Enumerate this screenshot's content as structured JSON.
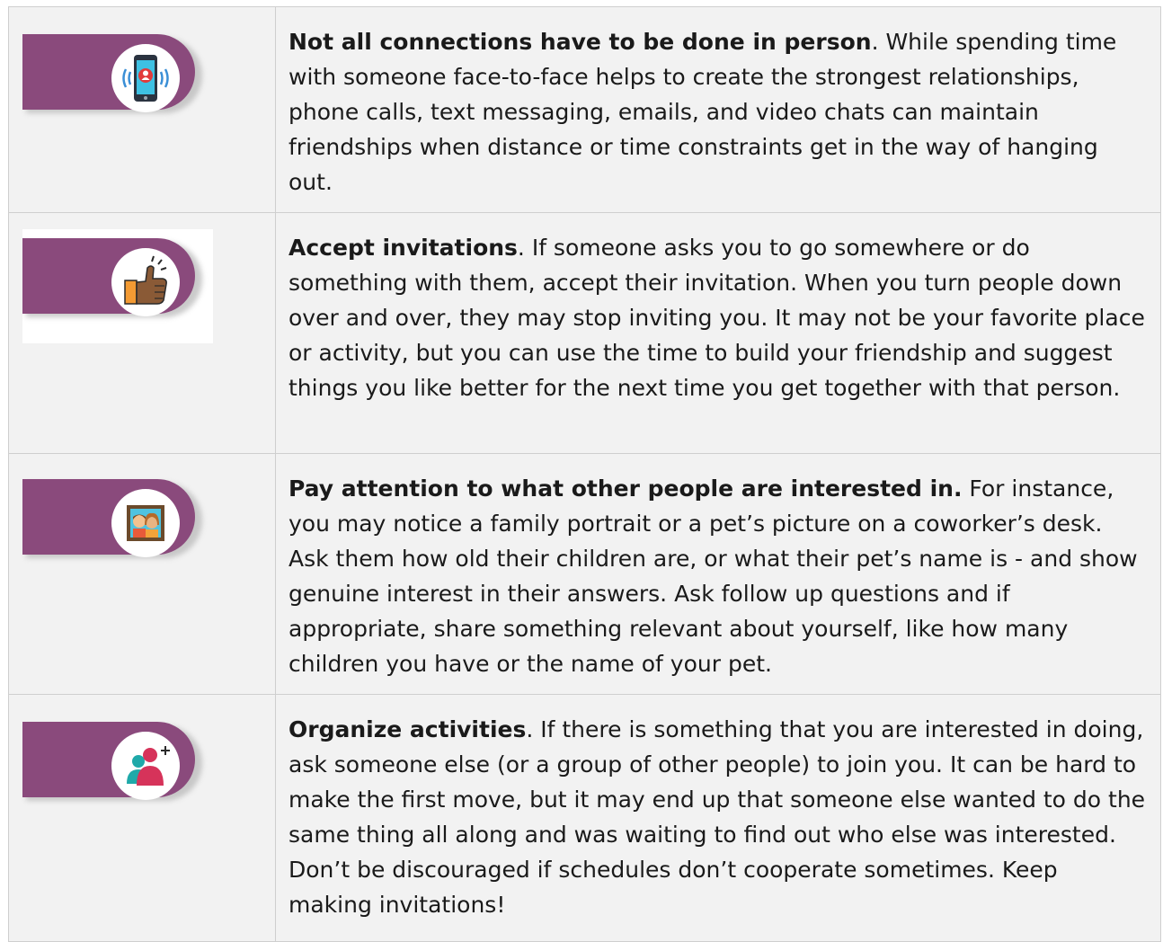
{
  "tips": [
    {
      "icon": "phone-call-icon",
      "heading": "Not all connections have to be done in person",
      "body": ". While spending time with someone face-to-face helps to create the strongest relationships, phone calls, text messaging, emails, and video chats can maintain friendships when distance or time constraints get in the way of hanging out."
    },
    {
      "icon": "thumbs-up-icon",
      "heading": "Accept invitations",
      "body": ". If someone asks you to go somewhere or do something with them, accept their invitation. When you turn people down over and over, they may stop inviting you. It may not be your favorite place or activity, but you can use the time to build your friendship and suggest things you like better for the next time you get together with that person."
    },
    {
      "icon": "family-portrait-icon",
      "heading": "Pay attention to what other people are interested in.",
      "body": " For instance, you may notice a family portrait or a pet’s picture on a coworker’s desk. Ask them how old their children are, or what their pet’s name is - and show genuine interest in their answers. Ask follow up questions and if appropriate, share something relevant about yourself, like how many children you have or the name of your pet."
    },
    {
      "icon": "add-group-icon",
      "heading": "Organize activities",
      "body": ". If there is something that you are interested in doing, ask someone else (or a group of other people) to join you. It can be hard to make the first move, but it may end up that someone else wanted to do the same thing all along and was waiting to find out who else was interested. Don’t be discouraged if schedules don’t cooperate sometimes. Keep making invitations!"
    }
  ],
  "colors": {
    "tab": "#8a4a7c",
    "cell_background": "#f2f2f2",
    "border": "#cfcfcf",
    "text": "#1a1a1a"
  }
}
